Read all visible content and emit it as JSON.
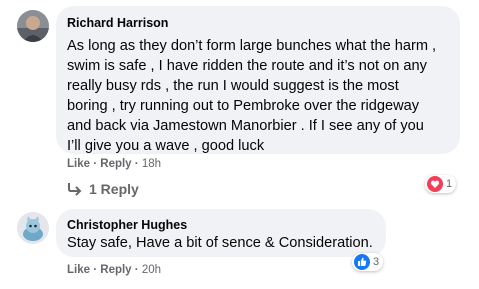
{
  "comments": [
    {
      "author": "Richard Harrison",
      "lines": [
        "As long as they don’t form large bunches what the harm ,",
        "swim is safe , I have ridden the route and it’s not on any",
        "really busy rds , the run I would suggest is the most",
        "boring , try running out to Pembroke over the ridgeway",
        "and back via Jamestown Manorbier . If I see any of you",
        "I’ll give you a wave , good luck"
      ],
      "like_label": "Like",
      "reply_label": "Reply",
      "separator": "·",
      "time": "18h",
      "reaction_icon": "love-heart-icon",
      "reaction_color": "#f33e58",
      "reaction_count": "1",
      "replies_label": "1 Reply"
    },
    {
      "author": "Christopher Hughes",
      "lines": [
        "Stay safe, Have a bit of sence & Consideration."
      ],
      "like_label": "Like",
      "reply_label": "Reply",
      "separator": "·",
      "time": "20h",
      "reaction_icon": "thumbs-up-icon",
      "reaction_color": "#1877f2",
      "reaction_count": "3"
    }
  ]
}
